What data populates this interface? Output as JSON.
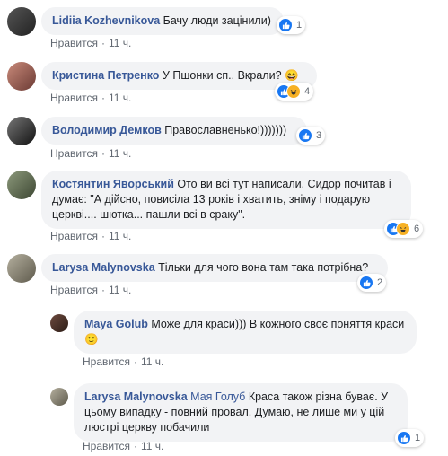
{
  "colors": {
    "author": "#385898",
    "bubble": "#f2f3f5",
    "meta": "#606770",
    "like": "#1877f2"
  },
  "like_label": "Нравится",
  "time_label": "11 ч.",
  "comments": [
    {
      "author": "Lidiia Kozhevnikova",
      "text": "Бачу люди зацінили)",
      "reactions": [
        "like-icon"
      ],
      "count": "1"
    },
    {
      "author": "Кристина Петренко",
      "text": "У Пшонки сп.. Вкрали? 😄",
      "reactions": [
        "like-icon",
        "haha-icon"
      ],
      "count": "4"
    },
    {
      "author": "Володимир Демков",
      "text": "Православненько!)))))))",
      "reactions": [
        "like-icon"
      ],
      "count": "3"
    },
    {
      "author": "Костянтин Яворський",
      "text": "Ото ви всі тут написали. Сидор почитав і думає: \"А дійсно, повисіла 13 років і хватить, зніму і подарую церкві.... шютка... пашли всі в сраку\".",
      "reactions": [
        "like-icon",
        "haha-icon"
      ],
      "count": "6"
    },
    {
      "author": "Larysa Malynovska",
      "text": "Тільки для чого вона там така потрібна?",
      "reactions": [
        "like-icon"
      ],
      "count": "2"
    }
  ],
  "replies": [
    {
      "author": "Maya Golub",
      "text": "Може для краси))) В кожного своє поняття краси 🙂",
      "reactions": [],
      "count": ""
    },
    {
      "author": "Larysa Malynovska",
      "mention": "Мая Голуб",
      "text": "Краса також різна буває. У цьому випадку - повний провал. Думаю, не лише ми у цій люстрі церкву побачили",
      "reactions": [
        "like-icon"
      ],
      "count": "1"
    }
  ]
}
